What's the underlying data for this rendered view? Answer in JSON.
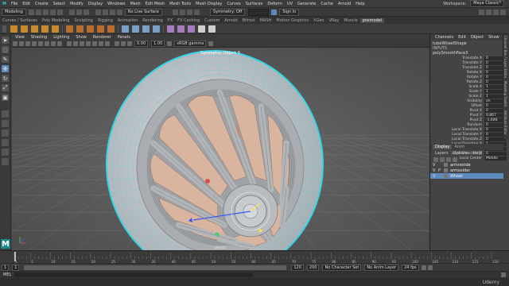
{
  "menubar": {
    "items": [
      "File",
      "Edit",
      "Create",
      "Select",
      "Modify",
      "Display",
      "Windows",
      "Mesh",
      "Edit Mesh",
      "Mesh Tools",
      "Mesh Display",
      "Curves",
      "Surfaces",
      "Deform",
      "UV",
      "Generate",
      "Cache",
      "Arnold",
      "Help"
    ],
    "workspace_label": "Workspace:",
    "workspace_value": "Maya Classic*"
  },
  "statusline": {
    "mode": "Modeling",
    "live_surface": "No Live Surface",
    "symmetry": "Symmetry: Off",
    "sign_in": "Sign In"
  },
  "shelf": {
    "tabs": [
      "Curves / Surfaces",
      "Poly Modeling",
      "Sculpting",
      "Rigging",
      "Animation",
      "Rendering",
      "FX",
      "FX Caching",
      "Custom",
      "Arnold",
      "Bifrost",
      "MASH",
      "Motion Graphics",
      "XGen",
      "VRay",
      "Muscle",
      "posmodel"
    ],
    "active_tab": 16,
    "icon_colors": [
      "#c98a2e",
      "#c98a2e",
      "#c98a2e",
      "#c98a2e",
      "#c98a2e",
      "#4d4d4d",
      "#b86d2a",
      "#b86d2a",
      "#b86d2a",
      "#b86d2a",
      "#b86d2a",
      "#4d4d4d",
      "#7aa0c8",
      "#7aa0c8",
      "#7aa0c8",
      "#7aa0c8",
      "#4d4d4d",
      "#a87dc0",
      "#a87dc0",
      "#a87dc0",
      "#d0d0d0",
      "#d0d0d0"
    ]
  },
  "toolbox": {
    "tools": [
      "select-arrow-icon",
      "lasso-icon",
      "paint-select-icon",
      "move-icon",
      "rotate-icon",
      "scale-icon",
      "last-tool-icon"
    ],
    "active": 3,
    "layouts": [
      "single-view-icon",
      "four-view-icon",
      "side-by-side-icon",
      "outliner-layout-icon",
      "graph-layout-icon",
      "uv-layout-icon"
    ]
  },
  "panel": {
    "menus": [
      "View",
      "Shading",
      "Lighting",
      "Show",
      "Renderer",
      "Panels"
    ],
    "near_clip": "0.00",
    "far_clip": "1.00",
    "color_space": "sRGB gamma"
  },
  "viewport": {
    "hud_top": "Symmetry: Object X",
    "hud_bottom": "persp",
    "background": "#5a5a5a",
    "tire_color": "#c8ccd0",
    "rim_color": "#b6b9bc",
    "wireframe_color": "#33d6e6",
    "disc_color": "#d9b49e"
  },
  "channelbox": {
    "tabs": [
      "Channels",
      "Edit",
      "Object",
      "Show"
    ],
    "object": "tubeWheelShape",
    "inputs_label": "INPUTS",
    "input_node": "polySmoothFace3",
    "attributes": [
      {
        "name": "Translate X",
        "value": "0"
      },
      {
        "name": "Translate Y",
        "value": "0"
      },
      {
        "name": "Translate Z",
        "value": "0"
      },
      {
        "name": "Rotate X",
        "value": "0"
      },
      {
        "name": "Rotate Y",
        "value": "0"
      },
      {
        "name": "Rotate Z",
        "value": "0"
      },
      {
        "name": "Scale X",
        "value": "1"
      },
      {
        "name": "Scale Y",
        "value": "1"
      },
      {
        "name": "Scale Z",
        "value": "1"
      },
      {
        "name": "Visibility",
        "value": "on"
      },
      {
        "name": "Offset",
        "value": "0"
      },
      {
        "name": "Pivot X",
        "value": "0"
      },
      {
        "name": "Pivot Y",
        "value": "0.867"
      },
      {
        "name": "Pivot Z",
        "value": "-1.646"
      },
      {
        "name": "Random",
        "value": "0"
      },
      {
        "name": "Local Translate X",
        "value": "0"
      },
      {
        "name": "Local Translate Y",
        "value": "0"
      },
      {
        "name": "Local Translate Z",
        "value": "0"
      },
      {
        "name": "Local Direction X",
        "value": "1"
      },
      {
        "name": "Local Direction Y",
        "value": "0"
      },
      {
        "name": "Local Direction Z",
        "value": "0"
      },
      {
        "name": "Local Center",
        "value": "Middle"
      }
    ]
  },
  "layers": {
    "tabs": [
      "Display",
      "Anim"
    ],
    "menus": [
      "Layers",
      "Options",
      "Help"
    ],
    "items": [
      {
        "v": "V",
        "p": "",
        "name": "armrestde"
      },
      {
        "v": "V",
        "p": "P",
        "name": "armsolder"
      },
      {
        "v": "V",
        "p": "",
        "name": "Wheel"
      }
    ],
    "selected": 2
  },
  "sidetabs": [
    "Channel Box / Layer Editor",
    "Modeling Toolkit",
    "Attribute Editor"
  ],
  "timeline": {
    "ticks": [
      "1",
      "5",
      "10",
      "15",
      "20",
      "25",
      "30",
      "35",
      "40",
      "45",
      "50",
      "55",
      "60",
      "65",
      "70",
      "75",
      "80",
      "85",
      "90",
      "95",
      "100",
      "105",
      "110",
      "115",
      "120"
    ],
    "current_frame": "1"
  },
  "range": {
    "start": "1",
    "inner_start": "1",
    "inner_end": "120",
    "end": "120",
    "end2": "200",
    "character_set": "No Character Set",
    "anim_layer": "No Anim Layer",
    "fps": "24 fps"
  },
  "mel": "MEL",
  "brand": "Udemy"
}
